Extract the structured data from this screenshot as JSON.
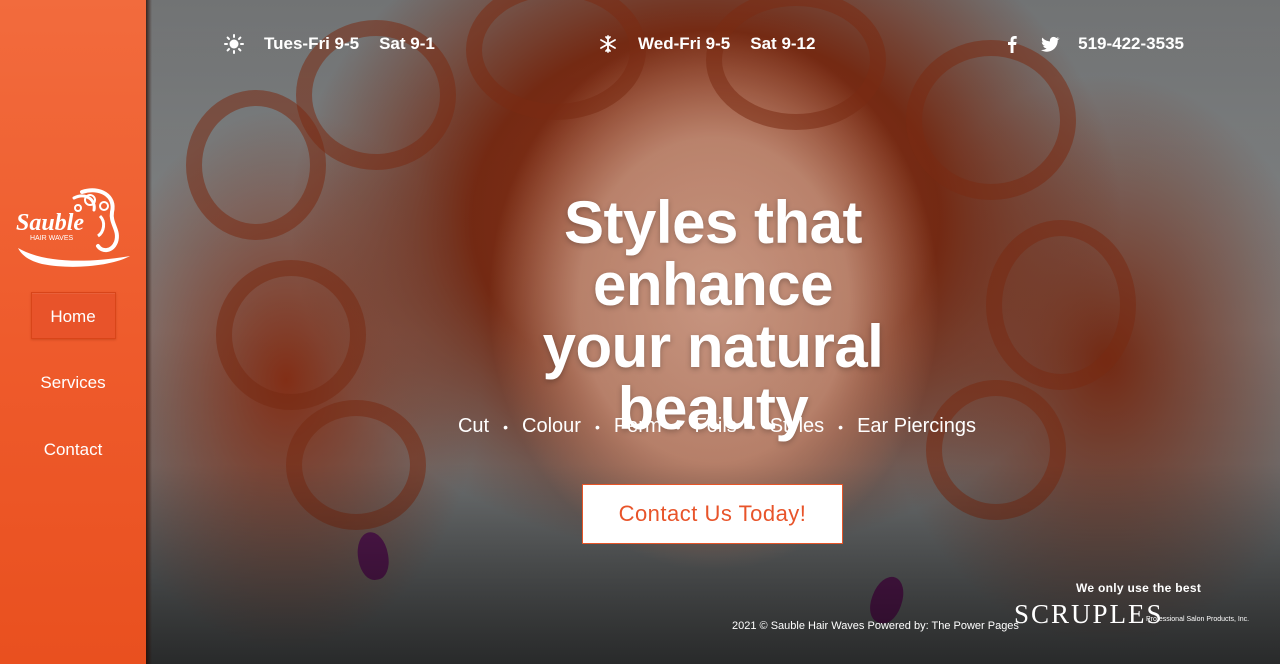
{
  "brand": {
    "logo_text": "Sauble",
    "logo_subtext": "HAIR WAVES",
    "accent": "#ee5a2b"
  },
  "nav": {
    "items": [
      {
        "label": "Home",
        "active": true
      },
      {
        "label": "Services",
        "active": false
      },
      {
        "label": "Contact",
        "active": false
      }
    ]
  },
  "topbar": {
    "summer": {
      "icon": "sun-icon",
      "weekday": "Tues-Fri 9-5",
      "saturday": "Sat 9-1"
    },
    "winter": {
      "icon": "snowflake-icon",
      "weekday": "Wed-Fri 9-5",
      "saturday": "Sat 9-12"
    },
    "social": [
      "facebook-icon",
      "twitter-icon"
    ],
    "phone": "519-422-3535"
  },
  "hero": {
    "headline_line1": "Styles that enhance",
    "headline_line2": "your natural beauty",
    "services": [
      "Cut",
      "Colour",
      "Perm",
      "Foils",
      "Styles",
      "Ear Piercings"
    ],
    "cta_label": "Contact Us Today!"
  },
  "footer": {
    "copyright": "2021 © Sauble Hair Waves Powered by: The Power Pages",
    "partner_tagline": "We only use the best",
    "partner_name": "SCRUPLES",
    "partner_sub": "Professional Salon Products, Inc."
  }
}
